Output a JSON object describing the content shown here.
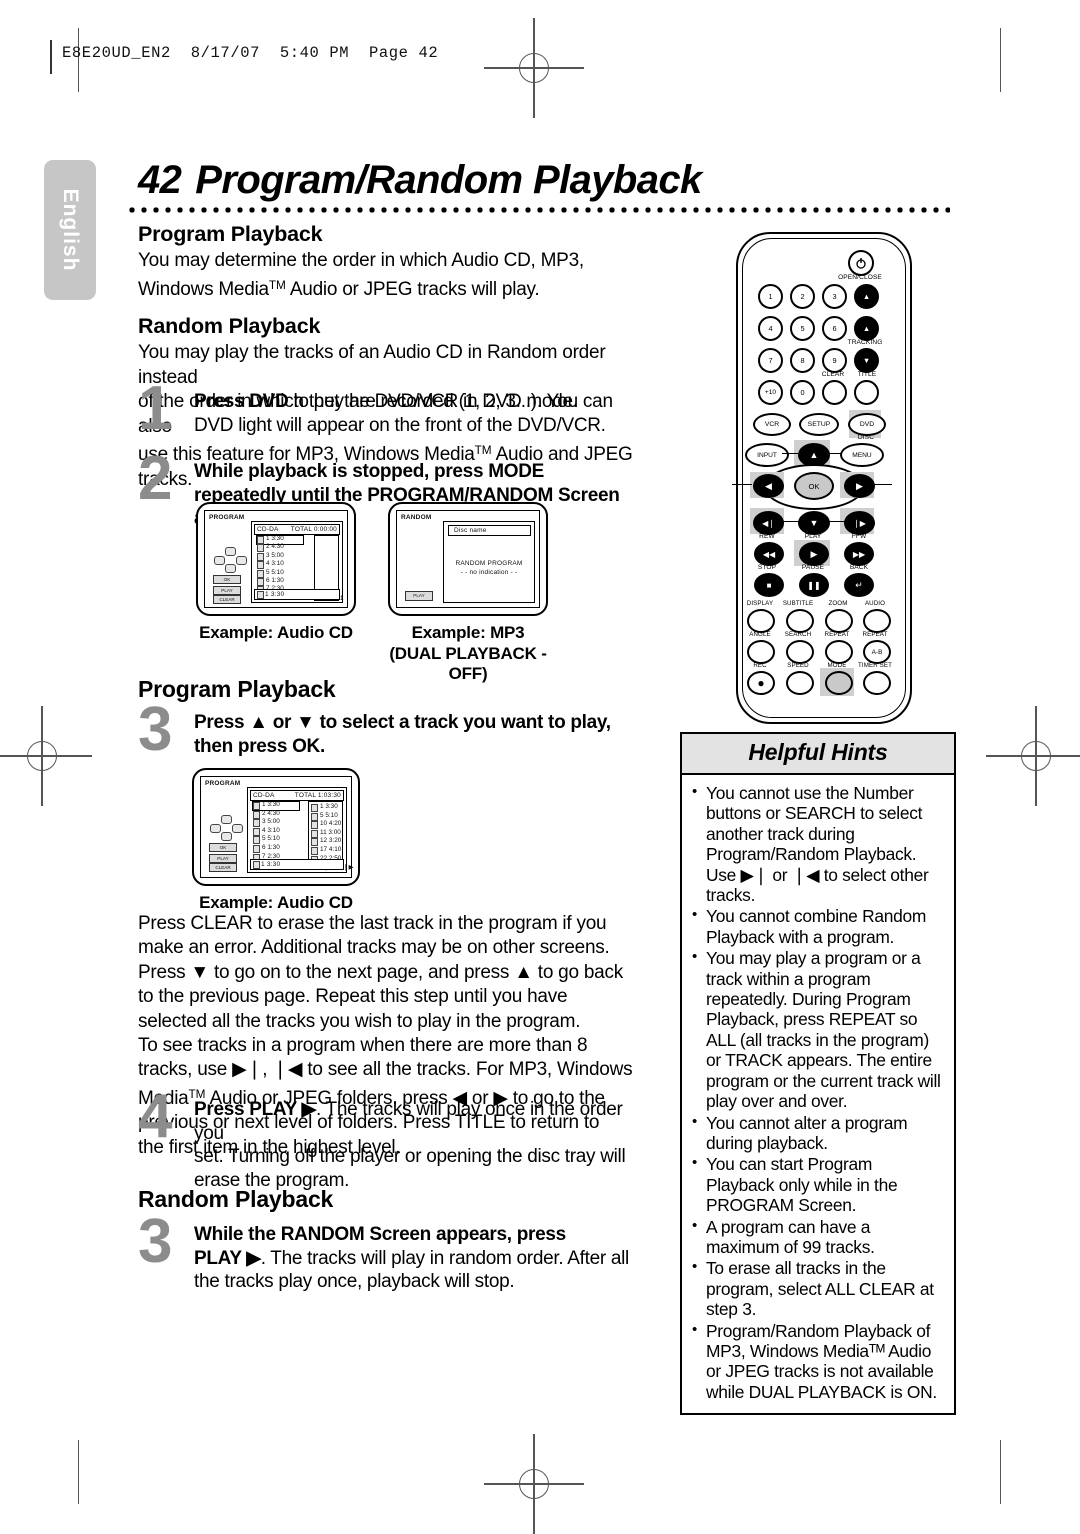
{
  "print": {
    "slug": "E8E20UD_EN2  8/17/07  5:40 PM  Page 42"
  },
  "sidebar": {
    "language_tab": "English"
  },
  "page": {
    "number": "42",
    "title": "Program/Random Playback"
  },
  "sections": {
    "program_intro_heading": "Program Playback",
    "program_intro_text_1": "You may determine the order in which Audio CD, MP3,",
    "program_intro_text_2a": "Windows Media",
    "program_intro_tm": "TM",
    "program_intro_text_2b": " Audio or JPEG tracks will play.",
    "random_intro_heading": "Random Playback",
    "random_intro_text_1": "You may play the tracks of an Audio CD in Random order instead",
    "random_intro_text_2": "of the order in which they are recorded (1, 2, 3...). You can also",
    "random_intro_text_3a": "use this feature for MP3, Windows Media",
    "random_intro_text_3b": " Audio and JPEG tracks.",
    "program_playback_heading": "Program Playback",
    "random_playback_heading": "Random Playback"
  },
  "steps": {
    "step1": {
      "num": "1",
      "bold": "Press DVD",
      "rest": " to put the DVD/VCR in DVD mode.",
      "line2": "DVD light will appear on the front of the DVD/VCR."
    },
    "step2": {
      "num": "2",
      "l1a": "While playback is stopped, press ",
      "l1b": "MODE",
      "l2a": "repeatedly until the ",
      "l2b": "PROGRAM/RANDOM",
      "l2c": " Screen",
      "l3": "appears."
    },
    "step3_program": {
      "num": "3",
      "l1a": "Press ",
      "up": "▲",
      "l1b": " or ",
      "down": "▼",
      "l1c": " to select a track you want to play,",
      "l2": "then press OK."
    },
    "step4": {
      "num": "4",
      "bold": "Press PLAY ",
      "play_glyph": "▶",
      "rest1": ". The tracks will play once in the order you",
      "line2": "set. Turning off the player or opening the disc tray will",
      "line3": "erase the program."
    },
    "step3_random": {
      "num": "3",
      "l1a": "While the ",
      "l1b": "RANDOM",
      "l1c": " Screen appears, press",
      "l2a": "PLAY ",
      "play_glyph": "▶",
      "l2b": ". The tracks will play in random order. After all",
      "l3": "the tracks play once, playback will stop."
    }
  },
  "paragraph": {
    "l1": "Press CLEAR to erase the last track in the program if you",
    "l2": "make an error. Additional tracks may be on other screens.",
    "l3a": "Press ",
    "l3_down": "▼",
    "l3b": " to go on to the next page, and press ",
    "l3_up": "▲",
    "l3c": " to go back",
    "l4": "to the previous page. Repeat this step until you have",
    "l5": "selected all the tracks you wish to play in the program.",
    "l6": "To see tracks in a program when there are more than 8",
    "l7a": "tracks, use ",
    "l7_next": "▶❘",
    "l7mid": ", ",
    "l7_prev": "❘◀",
    "l7b": " to see all the tracks. For MP3, Windows",
    "l8a": "Media",
    "l8tm": "TM",
    "l8b": " Audio or JPEG folders, press ",
    "l8_left": "◀",
    "l8c": " or ",
    "l8_right": "▶",
    "l8d": " to go to the",
    "l9": "previous or next level of folders. Press TITLE to return to",
    "l10": "the first item in the highest level."
  },
  "osd_program_1": {
    "title": "PROGRAM",
    "disc_type": "CD-DA",
    "total_label": "TOTAL 0:00:00",
    "tracks": [
      "1  3:30",
      "2  4:30",
      "3  5:00",
      "4  3:10",
      "5  5:10",
      "6  1:30",
      "7  2:30"
    ],
    "page_left": "1/4",
    "page_right": "1/1",
    "bottom_row": "1  3:30",
    "buttons": [
      "OK",
      "PLAY",
      "CLEAR"
    ],
    "caption": "Example: Audio CD"
  },
  "osd_random": {
    "title": "RANDOM",
    "disc_name": "Disc name",
    "center_1": "RANDOM  PROGRAM",
    "center_2": "- - no  indication - -",
    "play_button": "PLAY",
    "caption_1": "Example: MP3",
    "caption_2": "(DUAL PLAYBACK - OFF)"
  },
  "osd_program_2": {
    "title": "PROGRAM",
    "disc_type": "CD-DA",
    "total_label": "TOTAL 1:03:30",
    "tracks": [
      "1  3:30",
      "2  4:30",
      "3  5:00",
      "4  3:10",
      "5  5:10",
      "6  1:30",
      "7  2:30"
    ],
    "program_tracks": [
      "1   3:30",
      "5   5:10",
      "10  4:20",
      "11  3:00",
      "12  3:20",
      "17  4:10",
      "22  2:50"
    ],
    "page_left": "1/4",
    "page_right": "2/3",
    "bottom_row": "1  3:30",
    "buttons": [
      "OK",
      "PLAY",
      "CLEAR"
    ],
    "caption": "Example: Audio CD"
  },
  "remote": {
    "power_icon": "power-icon",
    "open_close": "OPEN/CLOSE",
    "tracking": "TRACKING",
    "numbers": [
      "1",
      "2",
      "3",
      "4",
      "5",
      "6",
      "7",
      "8",
      "9",
      "+10",
      "0"
    ],
    "clear": "CLEAR",
    "title_btn": "TITLE",
    "vcr": "VCR",
    "setup": "SETUP",
    "dvd": "DVD",
    "disc": "DISC",
    "menu": "MENU",
    "input": "INPUT",
    "ok": "OK",
    "rew": "REW",
    "play": "PLAY",
    "ffw": "FFW",
    "stop": "STOP",
    "pause": "PAUSE",
    "back": "BACK",
    "display": "DISPLAY",
    "subtitle": "SUBTITLE",
    "zoom": "ZOOM",
    "audio": "AUDIO",
    "angle": "ANGLE",
    "search": "SEARCH",
    "repeat": "REPEAT",
    "repeat2": "REPEAT",
    "ab": "A-B",
    "rec": "REC",
    "speed": "SPEED",
    "mode": "MODE",
    "timer_set": "TIMER SET"
  },
  "hints": {
    "heading": "Helpful Hints",
    "items": [
      "You cannot use the Number buttons or SEARCH to select another track during Program/Random Playback. Use ▶❘ or ❘◀ to select other tracks.",
      "You cannot combine Random Playback with a program.",
      "You may play a program or a track within a program repeatedly. During Program Playback, press REPEAT so ALL (all tracks in the program) or TRACK appears. The entire program or the current track will play over and over.",
      "You cannot alter a program during playback.",
      "You can start Program Playback only while in the PROGRAM Screen.",
      "A program can have a maximum of 99 tracks.",
      "To erase all tracks in the program, select ALL CLEAR at step 3.",
      "Program/Random Playback of MP3, Windows Mediaᵀᴹ Audio or JPEG tracks is not available while DUAL PLAYBACK is ON."
    ]
  }
}
